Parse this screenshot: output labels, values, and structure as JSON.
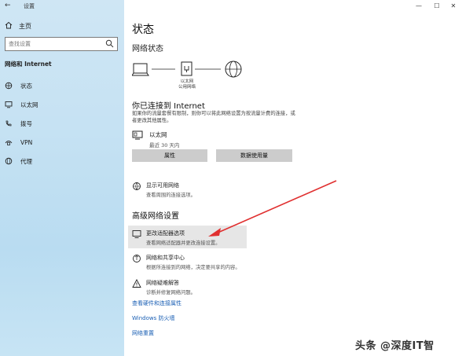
{
  "window": {
    "app_title": "设置",
    "controls": {
      "minimize": "—",
      "maximize": "☐",
      "close": "✕"
    }
  },
  "sidebar": {
    "home_label": "主页",
    "search_placeholder": "查找设置",
    "section_label": "网络和 Internet",
    "items": [
      {
        "label": "状态",
        "icon": "globe-status-icon"
      },
      {
        "label": "以太网",
        "icon": "ethernet-monitor-icon"
      },
      {
        "label": "拨号",
        "icon": "phone-dialup-icon"
      },
      {
        "label": "VPN",
        "icon": "vpn-icon"
      },
      {
        "label": "代理",
        "icon": "globe-proxy-icon"
      }
    ]
  },
  "main": {
    "title": "状态",
    "network_status_heading": "网络状态",
    "diagram": {
      "adapter_label_1": "以太网",
      "adapter_label_2": "公用网络"
    },
    "connected_heading": "你已连接到 Internet",
    "connected_desc": "如果你的流量套餐有限制，则你可以将此网络设置为按流量计费的连接，或者更改其他属性。",
    "ethernet": {
      "name": "以太网",
      "sub": "最近 30 天内"
    },
    "buttons": {
      "properties": "属性",
      "data_usage": "数据使用量"
    },
    "show_networks": {
      "title": "显示可用网络",
      "desc": "查看周围的连接选项。"
    },
    "advanced_heading": "高级网络设置",
    "adapter_options": {
      "title": "更改适配器选项",
      "desc": "查看网络适配器并更改连接设置。"
    },
    "sharing_center": {
      "title": "网络和共享中心",
      "desc": "根据所连接到的网络，决定要共享的内容。"
    },
    "troubleshooter": {
      "title": "网络疑难解答",
      "desc": "诊断并修复网络问题。"
    },
    "links": {
      "hardware_props": "查看硬件和连接属性",
      "firewall": "Windows 防火墙",
      "reset": "网络重置"
    },
    "accent_link_color": "#1a5fb4",
    "arrow_color": "#e03030"
  },
  "watermark": "头条 @深度IT智"
}
